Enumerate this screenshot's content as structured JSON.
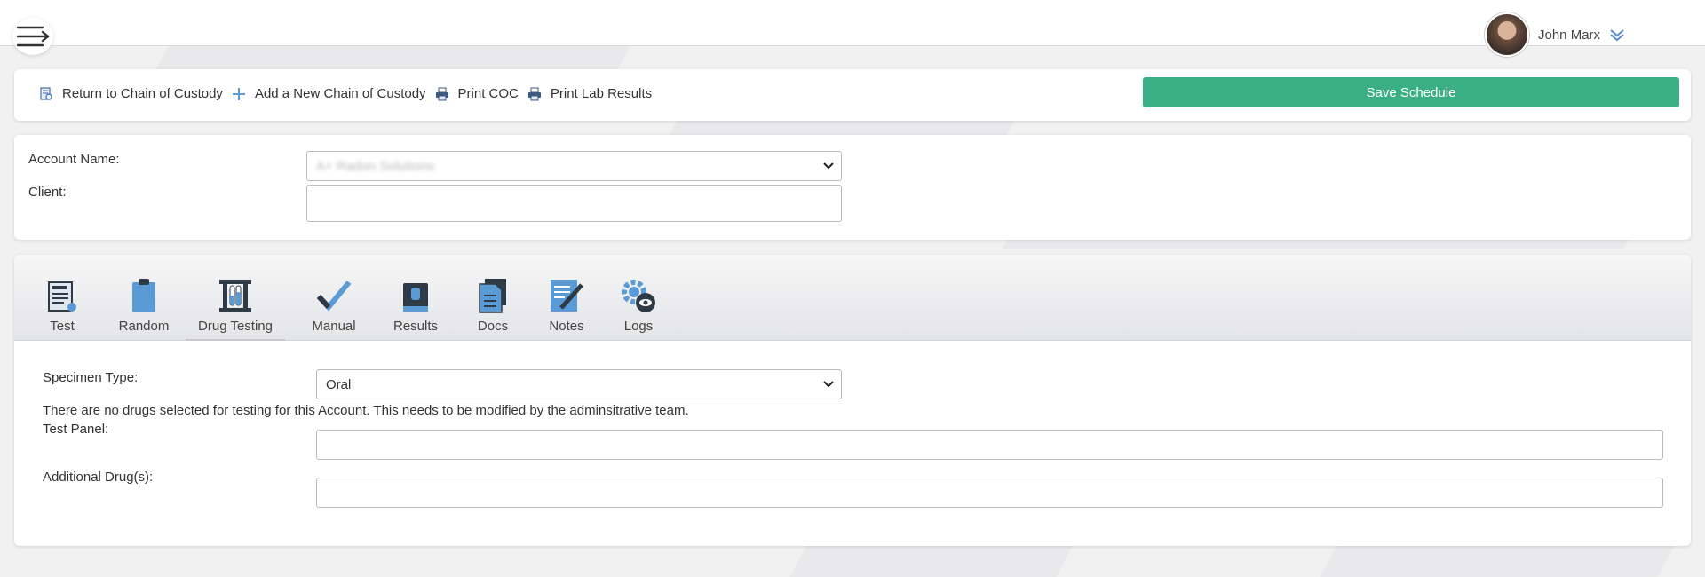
{
  "header": {
    "user_name": "John Marx"
  },
  "actions": {
    "return_label": "Return to Chain of Custody",
    "add_label": "Add a New Chain of Custody",
    "print_coc_label": "Print COC",
    "print_lab_label": "Print Lab Results",
    "save_label": "Save Schedule",
    "save_color": "#3aaf85"
  },
  "account": {
    "account_name_label": "Account Name:",
    "account_name_value": "A+ Radon Solutions",
    "client_label": "Client:",
    "client_value": ""
  },
  "tabs": [
    {
      "label": "Test",
      "icon": "test-report-icon"
    },
    {
      "label": "Random",
      "icon": "clipboard-icon"
    },
    {
      "label": "Drug Testing",
      "icon": "test-tubes-icon",
      "active": true
    },
    {
      "label": "Manual",
      "icon": "checkmark-icon"
    },
    {
      "label": "Results",
      "icon": "book-icon"
    },
    {
      "label": "Docs",
      "icon": "documents-icon"
    },
    {
      "label": "Notes",
      "icon": "notes-pencil-icon"
    },
    {
      "label": "Logs",
      "icon": "gear-eye-icon"
    }
  ],
  "drug_testing": {
    "specimen_label": "Specimen Type:",
    "specimen_value": "Oral",
    "notice": "There are no drugs selected for testing for this Account. This needs to be modified by the adminsitrative team.",
    "test_panel_label": "Test Panel:",
    "test_panel_value": "",
    "additional_label": "Additional Drug(s):",
    "additional_value": ""
  }
}
